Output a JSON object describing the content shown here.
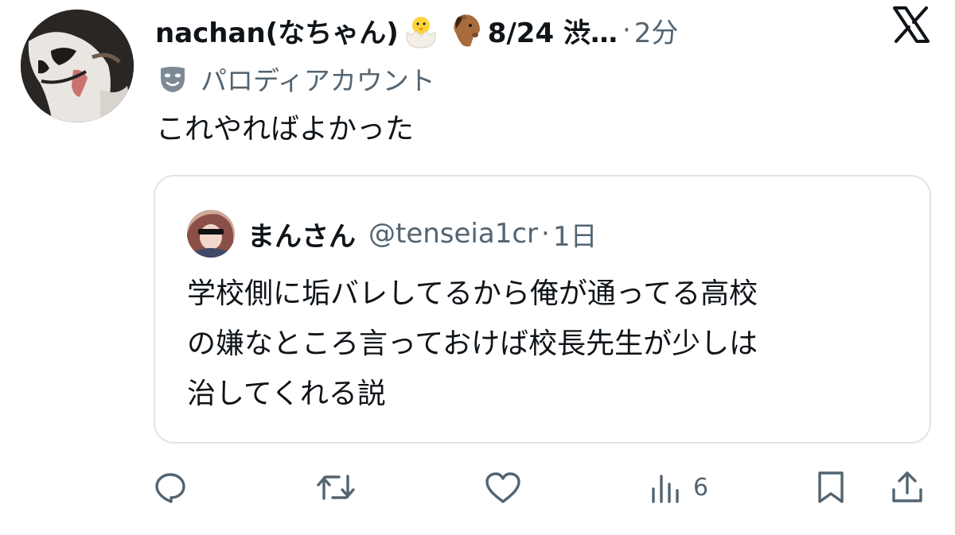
{
  "tweet": {
    "display_name": "nachan(なちゃん)",
    "name_suffix": "8/24 渋…",
    "separator": "·",
    "time": "2分",
    "label": "パロディアカウント",
    "text": "これやればよかった"
  },
  "quote": {
    "name": "まんさん",
    "handle": "@tenseia1cr",
    "separator": "·",
    "time": "1日",
    "lines": [
      "学校側に垢バレしてるから俺が通ってる高校",
      "の嫌なところ言っておけば校長先生が少しは",
      "治してくれる説"
    ]
  },
  "actions": {
    "views_count": "6"
  },
  "icons": {
    "header_emojis": [
      "hatching-chick-icon",
      "horse-face-icon"
    ],
    "logo": "x-logo-icon",
    "label_icon": "theater-mask-icon",
    "action_icons": [
      "reply-icon",
      "retweet-icon",
      "like-icon",
      "views-icon",
      "bookmark-icon",
      "share-icon"
    ]
  },
  "colors": {
    "text": "#0f1419",
    "secondary": "#536471",
    "border": "#dfe4e8"
  }
}
